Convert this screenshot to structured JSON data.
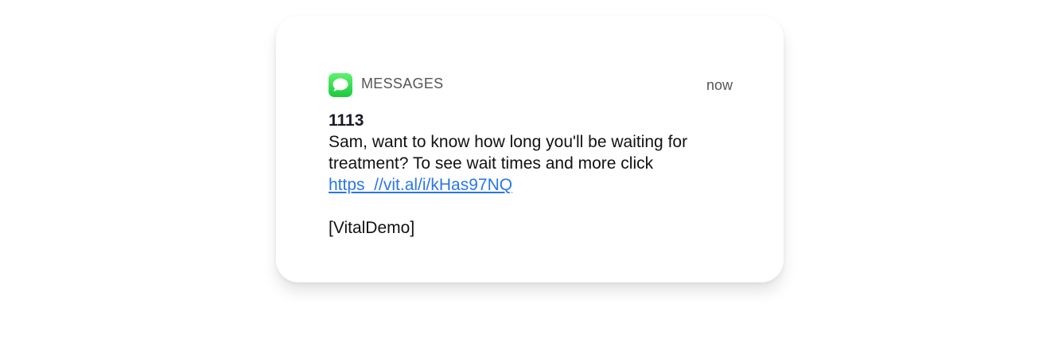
{
  "notification": {
    "app_icon": "messages-bubble-icon",
    "app_name": "MESSAGES",
    "time": "now",
    "sender": "1113",
    "body": "Sam, want to know how long you'll be waiting for treatment? To see wait times and more click",
    "link": "https_//vit.al/i/kHas97NQ",
    "signature": "[VitalDemo]",
    "icon_color": "#28d146",
    "link_color": "#2a76e6"
  }
}
